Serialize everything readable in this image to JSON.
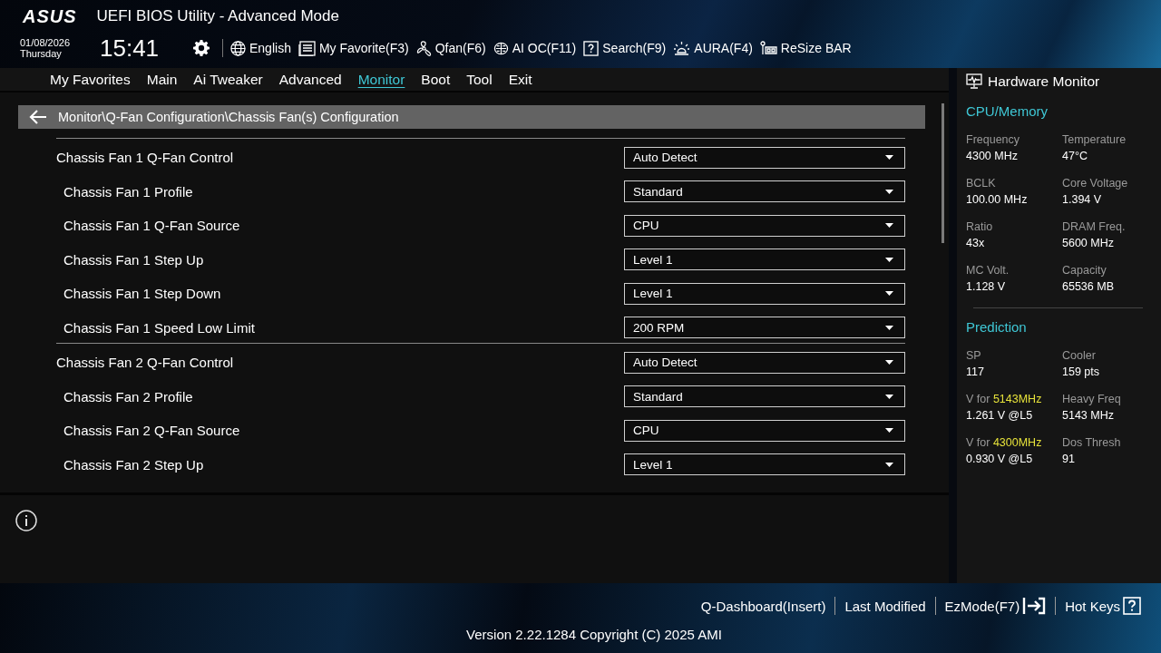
{
  "header": {
    "logo": "ASUS",
    "title": "UEFI BIOS Utility - Advanced Mode",
    "date": "01/08/2026",
    "day": "Thursday",
    "time": "15:41",
    "tools": [
      {
        "kind": "globe",
        "label": "English"
      },
      {
        "kind": "favorite",
        "label": "My Favorite(F3)"
      },
      {
        "kind": "fan",
        "label": "Qfan(F6)"
      },
      {
        "kind": "chip",
        "label": "AI OC(F11)"
      },
      {
        "kind": "help",
        "label": "Search(F9)"
      },
      {
        "kind": "aura",
        "label": "AURA(F4)"
      },
      {
        "kind": "bar",
        "label": "ReSize BAR"
      }
    ]
  },
  "tabs": [
    {
      "label": "My Favorites",
      "selected": false
    },
    {
      "label": "Main",
      "selected": false
    },
    {
      "label": "Ai Tweaker",
      "selected": false
    },
    {
      "label": "Advanced",
      "selected": false
    },
    {
      "label": "Monitor",
      "selected": true
    },
    {
      "label": "Boot",
      "selected": false
    },
    {
      "label": "Tool",
      "selected": false
    },
    {
      "label": "Exit",
      "selected": false
    }
  ],
  "breadcrumb": "Monitor\\Q-Fan Configuration\\Chassis Fan(s) Configuration",
  "settings": [
    {
      "label": "Chassis Fan 1 Q-Fan Control",
      "value": "Auto Detect",
      "children": [
        {
          "label": "Chassis Fan 1 Profile",
          "value": "Standard"
        },
        {
          "label": "Chassis Fan 1 Q-Fan Source",
          "value": "CPU"
        },
        {
          "label": "Chassis Fan 1 Step Up",
          "value": "Level 1"
        },
        {
          "label": "Chassis Fan 1 Step Down",
          "value": "Level 1"
        },
        {
          "label": "Chassis Fan 1 Speed Low Limit",
          "value": "200 RPM"
        }
      ]
    },
    {
      "label": "Chassis Fan 2 Q-Fan Control",
      "value": "Auto Detect",
      "children": [
        {
          "label": "Chassis Fan 2 Profile",
          "value": "Standard"
        },
        {
          "label": "Chassis Fan 2 Q-Fan Source",
          "value": "CPU"
        },
        {
          "label": "Chassis Fan 2 Step Up",
          "value": "Level 1"
        }
      ]
    }
  ],
  "hardware_monitor": {
    "title": "Hardware Monitor",
    "sections": [
      {
        "title": "CPU/Memory",
        "items": [
          {
            "label": "Frequency",
            "value": "4300 MHz"
          },
          {
            "label": "Temperature",
            "value": "47°C"
          },
          {
            "label": "BCLK",
            "value": "100.00 MHz"
          },
          {
            "label": "Core Voltage",
            "value": "1.394 V"
          },
          {
            "label": "Ratio",
            "value": "43x"
          },
          {
            "label": "DRAM Freq.",
            "value": "5600 MHz"
          },
          {
            "label": "MC Volt.",
            "value": "1.128 V"
          },
          {
            "label": "Capacity",
            "value": "65536 MB"
          }
        ]
      },
      {
        "title": "Prediction",
        "items": [
          {
            "label": "SP",
            "value": "117"
          },
          {
            "label": "Cooler",
            "value": "159 pts"
          },
          {
            "label": "V for",
            "highlight": "5143MHz",
            "value": "1.261 V @L5"
          },
          {
            "label": "Heavy Freq",
            "value": "5143 MHz"
          },
          {
            "label": "V for",
            "highlight": "4300MHz",
            "value": "0.930 V @L5"
          },
          {
            "label": "Dos Thresh",
            "value": "91"
          }
        ]
      }
    ]
  },
  "footer": {
    "links": [
      {
        "kind": "plain",
        "label": "Q-Dashboard(Insert)"
      },
      {
        "kind": "plain",
        "label": "Last Modified"
      },
      {
        "kind": "exit",
        "label": "EzMode(F7)"
      },
      {
        "kind": "help",
        "label": "Hot Keys"
      }
    ],
    "version": "Version 2.22.1284 Copyright (C) 2025 AMI"
  }
}
